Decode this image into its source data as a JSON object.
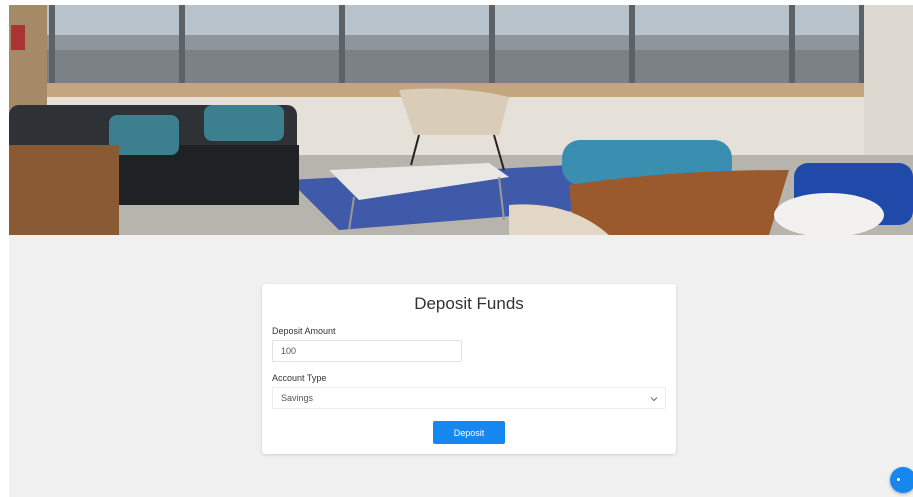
{
  "hero": {
    "image_description_icon": "office-lounge-photo"
  },
  "deposit_form": {
    "title": "Deposit Funds",
    "amount_label": "Deposit Amount",
    "amount_value": "100",
    "account_type_label": "Account Type",
    "account_type_value": "Savings",
    "submit_label": "Deposit"
  },
  "colors": {
    "accent": "#1787f0",
    "page_background": "#f0f0f0",
    "card_background": "#ffffff"
  },
  "floating": {
    "icon": "chat-icon"
  }
}
